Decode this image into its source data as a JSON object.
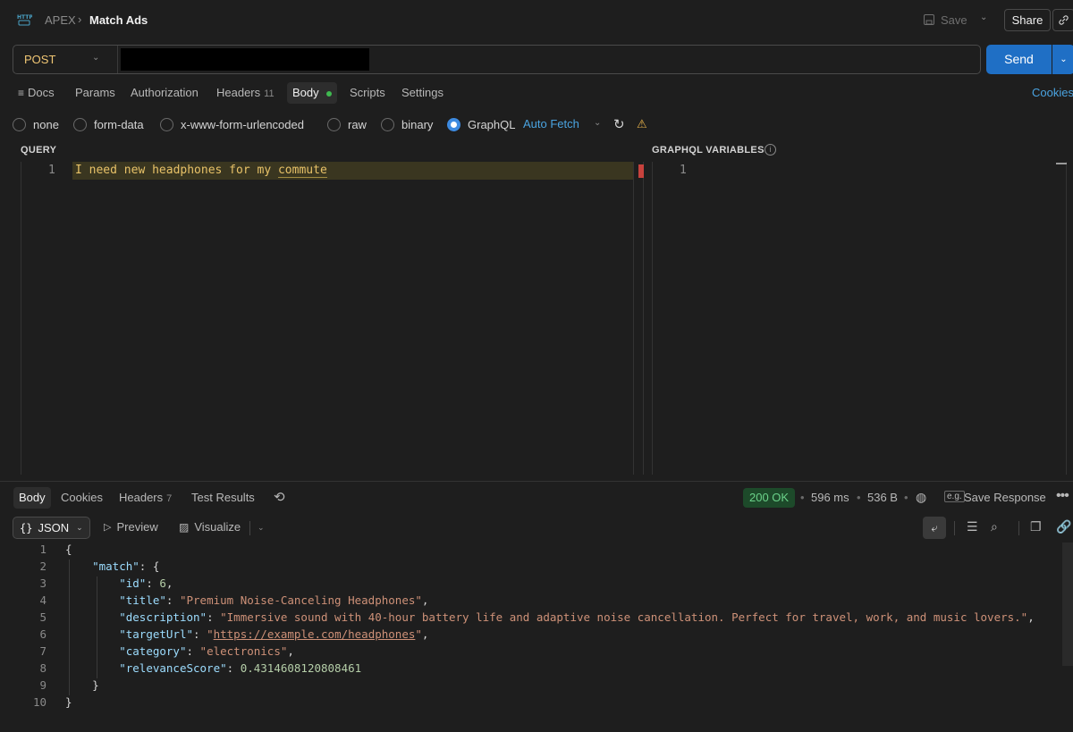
{
  "header": {
    "workspace": "APEX",
    "request_name": "Match Ads",
    "save_label": "Save",
    "share_label": "Share"
  },
  "request": {
    "method": "POST",
    "url": "",
    "send_label": "Send"
  },
  "request_tabs": {
    "docs": "Docs",
    "params": "Params",
    "authorization": "Authorization",
    "headers": "Headers",
    "headers_count": "11",
    "body": "Body",
    "scripts": "Scripts",
    "settings": "Settings",
    "cookies": "Cookies"
  },
  "body_types": {
    "none": "none",
    "form_data": "form-data",
    "urlencoded": "x-www-form-urlencoded",
    "raw": "raw",
    "binary": "binary",
    "graphql": "GraphQL",
    "selected": "GraphQL",
    "auto_fetch": "Auto Fetch"
  },
  "query_editor": {
    "label": "QUERY",
    "line_number": "1",
    "text_prefix": "I need new headphones for my ",
    "text_last": "commute"
  },
  "variables_editor": {
    "label": "GRAPHQL VARIABLES",
    "line_number": "1"
  },
  "response_tabs": {
    "body": "Body",
    "cookies": "Cookies",
    "headers": "Headers",
    "headers_count": "7",
    "test_results": "Test Results"
  },
  "response_meta": {
    "status": "200 OK",
    "time": "596 ms",
    "size": "536 B",
    "eg": "e.g.",
    "save_response": "Save Response"
  },
  "response_toolbar": {
    "format": "JSON",
    "preview": "Preview",
    "visualize": "Visualize"
  },
  "response_json": {
    "id": "6",
    "title": "\"Premium Noise-Canceling Headphones\"",
    "description": "\"Immersive sound with 40-hour battery life and adaptive noise cancellation. Perfect for travel, work, and music lovers.\"",
    "targetUrl": "https://example.com/headphones",
    "category": "\"electronics\"",
    "relevanceScore": "0.4314608120808461"
  },
  "colors": {
    "accent": "#1f6fc5",
    "status_ok_bg": "#1d4a2a",
    "status_ok_text": "#6bd28a",
    "method": "#f0c674",
    "link": "#4aa3e0"
  }
}
